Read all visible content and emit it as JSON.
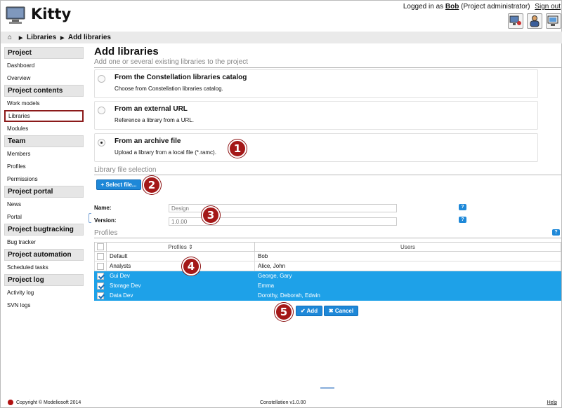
{
  "app": {
    "title": "Kitty"
  },
  "login": {
    "prefix": "Logged in as",
    "user": "Bob",
    "role": "(Project administrator)",
    "signout": "Sign out"
  },
  "breadcrumb": {
    "home_icon": "home-icon",
    "items": [
      "Libraries",
      "Add libraries"
    ]
  },
  "sidebar": {
    "sections": [
      {
        "title": "Project",
        "items": [
          "Dashboard",
          "Overview"
        ]
      },
      {
        "title": "Project contents",
        "items": [
          "Work models",
          "Libraries",
          "Modules"
        ]
      },
      {
        "title": "Team",
        "items": [
          "Members",
          "Profiles",
          "Permissions"
        ]
      },
      {
        "title": "Project portal",
        "items": [
          "News",
          "Portal"
        ]
      },
      {
        "title": "Project bugtracking",
        "items": [
          "Bug tracker"
        ]
      },
      {
        "title": "Project automation",
        "items": [
          "Scheduled tasks"
        ]
      },
      {
        "title": "Project log",
        "items": [
          "Activity log",
          "SVN logs"
        ]
      }
    ],
    "active_item": "Libraries"
  },
  "main": {
    "title": "Add libraries",
    "subtitle": "Add one or several existing libraries to the project",
    "options": [
      {
        "title": "From the Constellation libraries catalog",
        "desc": "Choose from Constellation libraries catalog.",
        "checked": false
      },
      {
        "title": "From an external URL",
        "desc": "Reference a library from a URL.",
        "checked": false
      },
      {
        "title": "From an archive file",
        "desc": "Upload a library from a local file (*.ramc).",
        "checked": true
      }
    ],
    "file_section": {
      "label": "Library file selection",
      "select_button": "Select file..."
    },
    "form": {
      "name_label": "Name:",
      "name_placeholder": "Design",
      "version_label": "Version:",
      "version_placeholder": "1.0.00"
    },
    "profiles_section": {
      "label": "Profiles",
      "col_profiles": "Profiles",
      "col_users": "Users",
      "rows": [
        {
          "profile": "Default",
          "users": "Bob",
          "checked": false
        },
        {
          "profile": "Analysts",
          "users": "Alice, John",
          "checked": false
        },
        {
          "profile": "Gui Dev",
          "users": "George, Gary",
          "checked": true
        },
        {
          "profile": "Storage Dev",
          "users": "Emma",
          "checked": true
        },
        {
          "profile": "Data Dev",
          "users": "Dorothy, Deborah, Edwin",
          "checked": true
        }
      ]
    },
    "buttons": {
      "add": "Add",
      "cancel": "Cancel"
    },
    "help_label": "?"
  },
  "badges": [
    "1",
    "2",
    "3",
    "4",
    "5"
  ],
  "footer": {
    "copyright": "Copyright © Modeliosoft 2014",
    "version": "Constellation v1.0.00",
    "help": "Help"
  },
  "colors": {
    "accent": "#1e88d8",
    "selection": "#1ea1e8",
    "badge": "#a41818",
    "active_border": "#8b1a1a"
  }
}
